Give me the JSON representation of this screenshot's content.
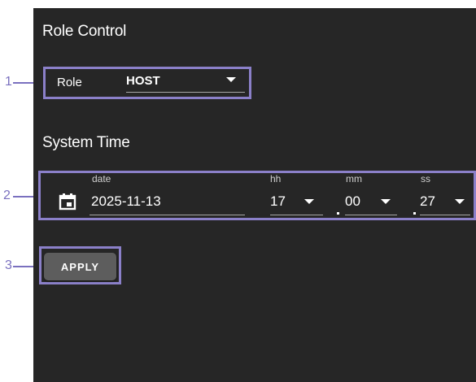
{
  "role_control": {
    "title": "Role Control",
    "role_label": "Role",
    "role_value": "HOST"
  },
  "system_time": {
    "title": "System Time",
    "date_label": "date",
    "date_value": "2025-11-13",
    "hh_label": "hh",
    "hh_value": "17",
    "mm_label": "mm",
    "mm_value": "00",
    "ss_label": "ss",
    "ss_value": "27"
  },
  "actions": {
    "apply_label": "APPLY"
  },
  "callouts": [
    "1",
    "2",
    "3"
  ],
  "icons": {
    "calendar": "calendar-icon",
    "dropdown": "triangle-down-icon"
  },
  "colors": {
    "panel": "#262626",
    "callout": "#8b80c9",
    "button": "#5d5d5d"
  }
}
